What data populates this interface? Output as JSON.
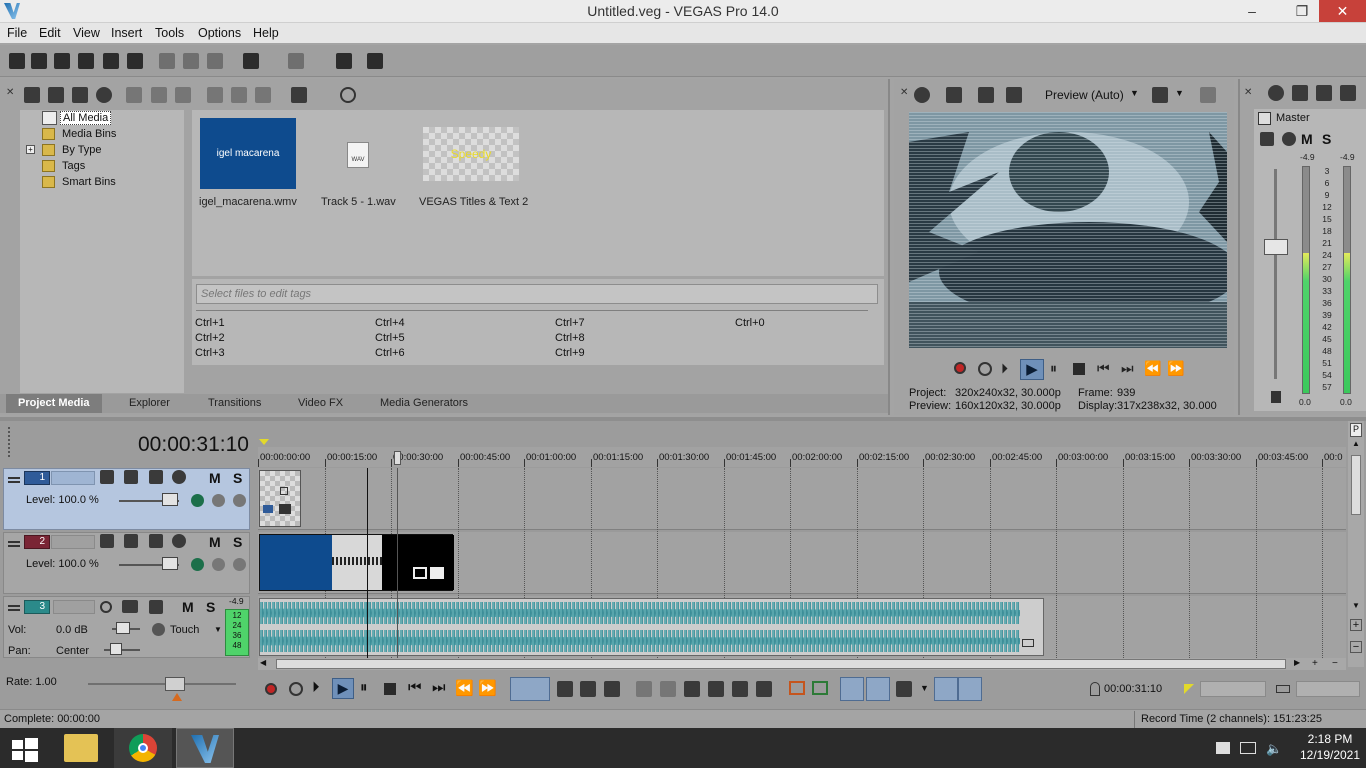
{
  "window": {
    "title": "Untitled.veg - VEGAS Pro 14.0",
    "minimize": "–",
    "maximize": "❐",
    "close": "✕"
  },
  "menu": [
    "File",
    "Edit",
    "View",
    "Insert",
    "Tools",
    "Options",
    "Help"
  ],
  "tree": {
    "items": [
      "All Media",
      "Media Bins",
      "By Type",
      "Tags",
      "Smart Bins"
    ],
    "expander": "+"
  },
  "media": [
    {
      "thumb_text": "igel macarena",
      "label": "igel_macarena.wmv"
    },
    {
      "thumb_text": "WAV",
      "label": "Track 5 - 1.wav"
    },
    {
      "thumb_text": "Speedy",
      "label": "VEGAS Titles & Text 2"
    }
  ],
  "tags": {
    "placeholder": "Select files to edit tags",
    "shortcuts": [
      "Ctrl+1",
      "Ctrl+2",
      "Ctrl+3",
      "Ctrl+4",
      "Ctrl+5",
      "Ctrl+6",
      "Ctrl+7",
      "Ctrl+8",
      "Ctrl+9",
      "Ctrl+0"
    ]
  },
  "tabs": [
    "Project Media",
    "Explorer",
    "Transitions",
    "Video FX",
    "Media Generators"
  ],
  "preview": {
    "mode": "Preview (Auto)",
    "project_label": "Project:",
    "project_value": "320x240x32, 30.000p",
    "frame_label": "Frame:",
    "frame_value": "939",
    "preview_label": "Preview:",
    "preview_value": "160x120x32, 30.000p",
    "display_label": "Display:",
    "display_value": "317x238x32, 30.000"
  },
  "master": {
    "title": "Master",
    "m": "M",
    "s": "S",
    "peak_left": "-4.9",
    "peak_right": "-4.9",
    "scale": [
      "3",
      "6",
      "9",
      "12",
      "15",
      "18",
      "21",
      "24",
      "27",
      "30",
      "33",
      "36",
      "39",
      "42",
      "45",
      "48",
      "51",
      "54",
      "57"
    ],
    "bottom_left": "0.0",
    "bottom_right": "0.0",
    "level_fraction": 0.62
  },
  "timeline": {
    "timecode": "00:00:31:10",
    "ruler": [
      "00:00:00:00",
      "00:00:15:00",
      "00:00:30:00",
      "00:00:45:00",
      "00:01:00:00",
      "00:01:15:00",
      "00:01:30:00",
      "00:01:45:00",
      "00:02:00:00",
      "00:02:15:00",
      "00:02:30:00",
      "00:02:45:00",
      "00:03:00:00",
      "00:03:15:00",
      "00:03:30:00",
      "00:03:45:00",
      "00:0"
    ]
  },
  "tracks": [
    {
      "number": "1",
      "level": "Level: 100.0 %",
      "m": "M",
      "s": "S",
      "color": "#2f5b99"
    },
    {
      "number": "2",
      "level": "Level: 100.0 %",
      "m": "M",
      "s": "S",
      "color": "#7a2535"
    },
    {
      "number": "3",
      "vol_label": "Vol:",
      "vol": "0.0 dB",
      "pan_label": "Pan:",
      "pan": "Center",
      "touch": "Touch",
      "m": "M",
      "s": "S",
      "peak": "-4.9",
      "meter": [
        "12",
        "24",
        "36",
        "48"
      ],
      "color": "#2b8a8a"
    }
  ],
  "transport": {
    "rate": "Rate: 1.00",
    "cursor_time": "00:00:31:10"
  },
  "status": {
    "left": "Complete: 00:00:00",
    "right": "Record Time (2 channels): 151:23:25"
  },
  "taskbar": {
    "time": "2:18 PM",
    "date": "12/19/2021"
  }
}
